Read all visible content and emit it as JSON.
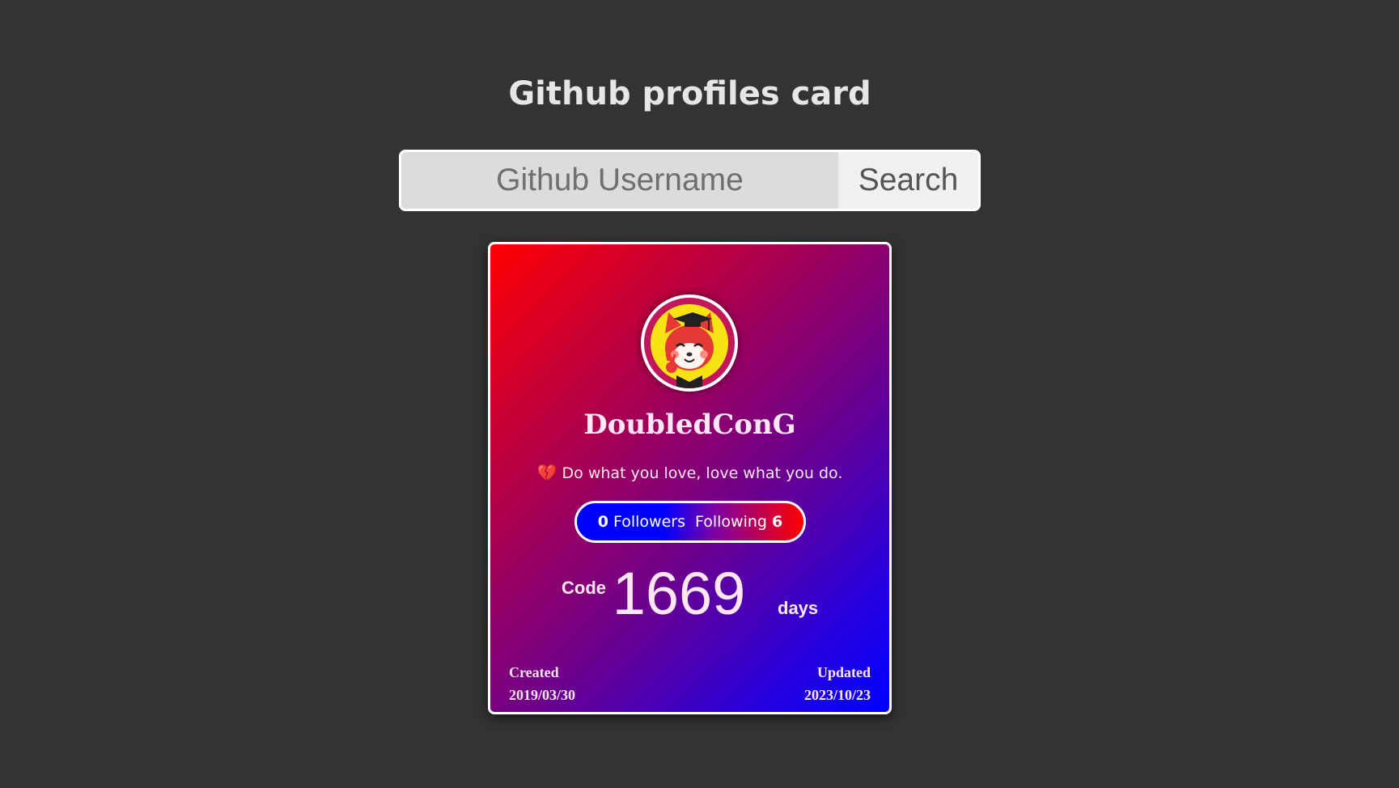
{
  "page": {
    "title": "Github profiles card"
  },
  "search": {
    "placeholder": "Github Username",
    "value": "",
    "button_label": "Search"
  },
  "profile": {
    "username": "DoubledConG",
    "bio_icon": "💔",
    "bio": "Do what you love, love what you do.",
    "followers_count": "0",
    "followers_label": "Followers",
    "following_label": "Following",
    "following_count": "6",
    "code_label": "Code",
    "code_days": "1669",
    "code_unit": "days",
    "created_label": "Created",
    "created_date": "2019/03/30",
    "updated_label": "Updated",
    "updated_date": "2023/10/23"
  },
  "colors": {
    "background": "#333333",
    "card_gradient_start": "#ff0000",
    "card_gradient_end": "#0000ff",
    "followers_accent": "#0000ff",
    "following_accent": "#ff0000"
  },
  "icons": {
    "avatar": "fox-graduate-avatar",
    "bio": "broken-heart-icon"
  }
}
